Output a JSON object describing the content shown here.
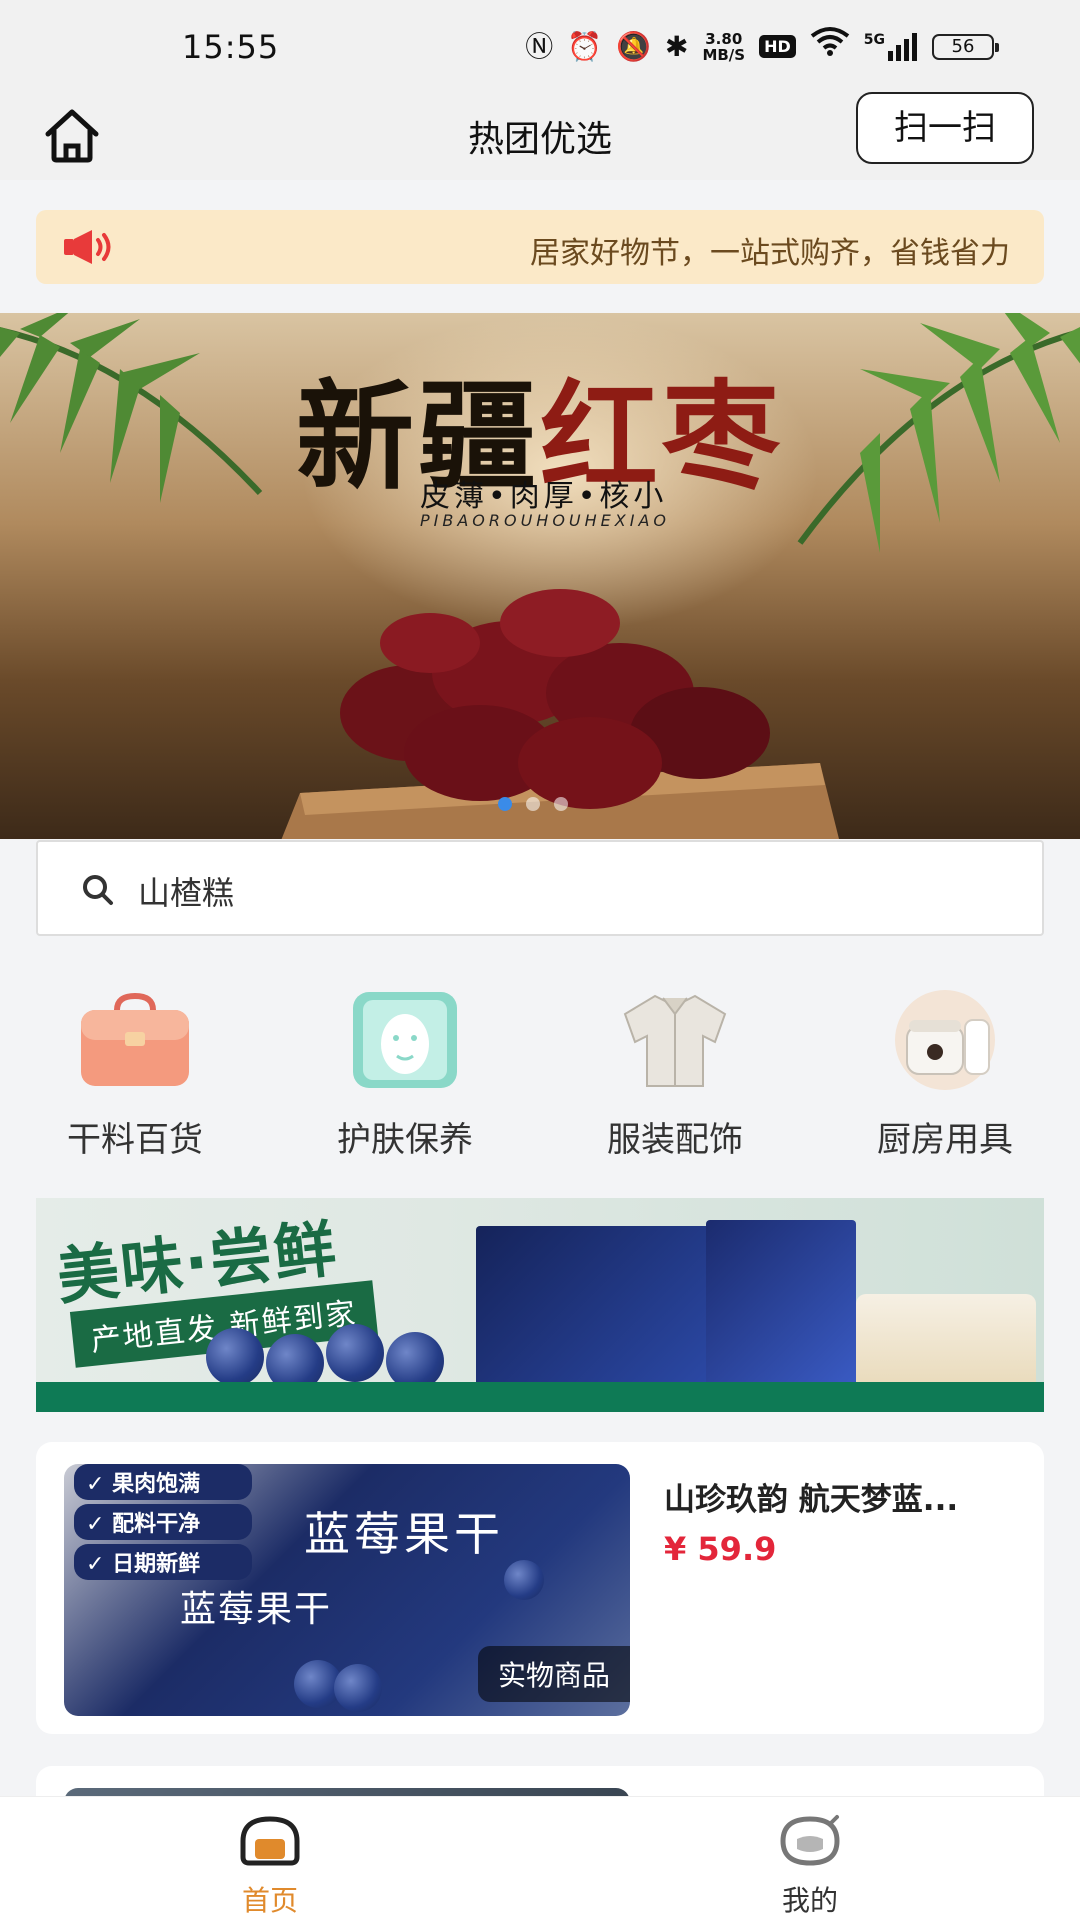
{
  "status_bar": {
    "time": "15:55",
    "net_speed_value": "3.80",
    "net_speed_unit": "MB/S",
    "hd": "HD",
    "network": "5G",
    "battery": "56"
  },
  "header": {
    "title": "热团优选",
    "scan_label": "扫一扫"
  },
  "notice": {
    "text": "居家好物节，一站式购齐，省钱省力"
  },
  "banner": {
    "title_black": "新疆",
    "title_red": "红枣",
    "subtitle": "皮薄•肉厚•核小",
    "subtitle_en": "PIBAOROUHOUHEXIAO",
    "slide_count": 3,
    "active_slide": 0
  },
  "search": {
    "placeholder": "山楂糕"
  },
  "categories": [
    {
      "label": "干料百货",
      "icon": "toolbox-icon"
    },
    {
      "label": "护肤保养",
      "icon": "face-mask-icon"
    },
    {
      "label": "服装配饰",
      "icon": "shirt-icon"
    },
    {
      "label": "厨房用具",
      "icon": "rice-cooker-icon"
    }
  ],
  "promo": {
    "title": "美味·尝鲜",
    "subtitle": "产地直发 新鲜到家"
  },
  "products": [
    {
      "name": "山珍玖韵 航天梦蓝...",
      "price": "¥ 59.9",
      "tag": "实物商品",
      "features": [
        "果肉饱满",
        "配料干净",
        "日期新鲜"
      ],
      "image_title": "蓝莓果干"
    }
  ],
  "tabs": [
    {
      "label": "首页",
      "active": true
    },
    {
      "label": "我的",
      "active": false
    }
  ],
  "colors": {
    "accent": "#e08a2c",
    "price": "#e3263a",
    "notice_bg": "#fbe9c8",
    "promo_green": "#1a6b44"
  }
}
